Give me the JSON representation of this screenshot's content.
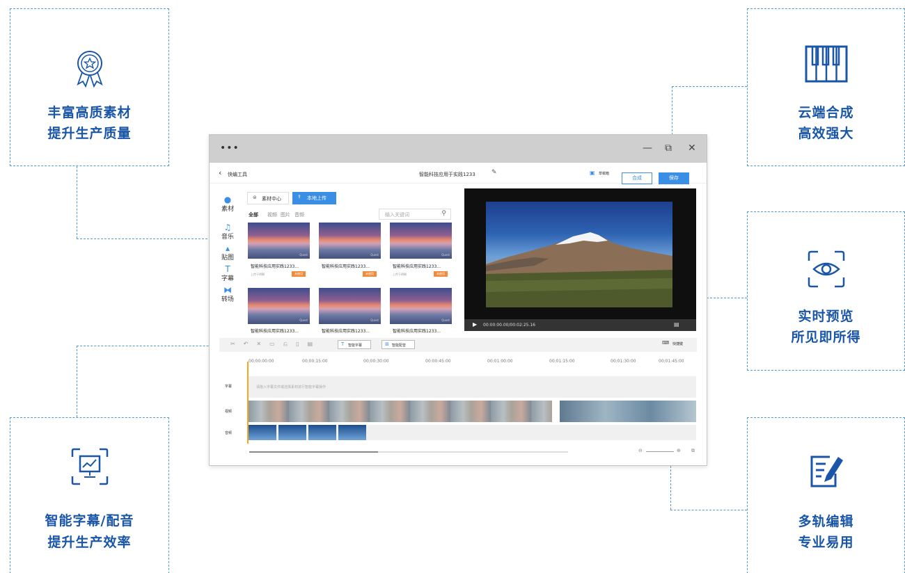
{
  "features": {
    "f1": {
      "line1": "丰富高质素材",
      "line2": "提升生产质量",
      "icon": "award-ribbon-icon"
    },
    "f2": {
      "line1": "云端合成",
      "line2": "高效强大",
      "icon": "piano-keys-icon"
    },
    "f3": {
      "line1": "实时预览",
      "line2": "所见即所得",
      "icon": "eye-scan-icon"
    },
    "f4": {
      "line1": "智能字幕/配音",
      "line2": "提升生产效率",
      "icon": "presentation-chart-icon"
    },
    "f5": {
      "line1": "多轨编辑",
      "line2": "专业易用",
      "icon": "edit-list-icon"
    }
  },
  "app": {
    "dots": "•••",
    "back_label": "快编工具",
    "project_title": "智能科技应用于实践1233",
    "draft_label": "草稿箱",
    "compose_label": "合成",
    "save_label": "保存",
    "nav": [
      {
        "label": "素材",
        "icon": "play-circle-icon"
      },
      {
        "label": "音乐",
        "icon": "music-note-icon"
      },
      {
        "label": "贴图",
        "icon": "image-icon"
      },
      {
        "label": "字幕",
        "icon": "text-icon"
      },
      {
        "label": "转场",
        "icon": "transition-icon"
      }
    ],
    "source_tabs": {
      "center": "素材中心",
      "upload": "本地上传"
    },
    "filters": [
      "全部",
      "视频",
      "图片",
      "音频"
    ],
    "search_placeholder": "输入关键词",
    "cards": [
      {
        "title": "智能科技应用实践1233...",
        "sub": "上传于明朝",
        "tag": "未使用",
        "wm": "Quest"
      },
      {
        "title": "智能科技应用实践1233...",
        "sub": "",
        "tag": "未使用",
        "wm": "Quest"
      },
      {
        "title": "智能科技应用实践1233...",
        "sub": "上传于明朝",
        "tag": "未使用",
        "wm": "Quest"
      },
      {
        "title": "智能科技应用实践1233...",
        "sub": "",
        "tag": "",
        "wm": "Quest"
      },
      {
        "title": "智能科技应用实践1233...",
        "sub": "",
        "tag": "",
        "wm": "Quest"
      },
      {
        "title": "智能科技应用实践1233...",
        "sub": "",
        "tag": "",
        "wm": "Quest"
      }
    ],
    "timecode": "00:00:00.00/00:02:25.16",
    "smart_subtitle": "智能字幕",
    "smart_dub": "智能配音",
    "shortcut_label": "快捷键",
    "ruler": [
      "00:00:00:00",
      "00:00:15:00",
      "00:00:30:00",
      "00:00:45:00",
      "00:01:00:00",
      "00:01:15:00",
      "00:01:30:00",
      "00:01:45:00"
    ],
    "tracks": {
      "subtitle_label": "字幕",
      "subtitle_hint": "请拖入字幕文件或选择素材进行智能字幕操作",
      "video_label": "视频",
      "audio_label": "音频"
    }
  }
}
